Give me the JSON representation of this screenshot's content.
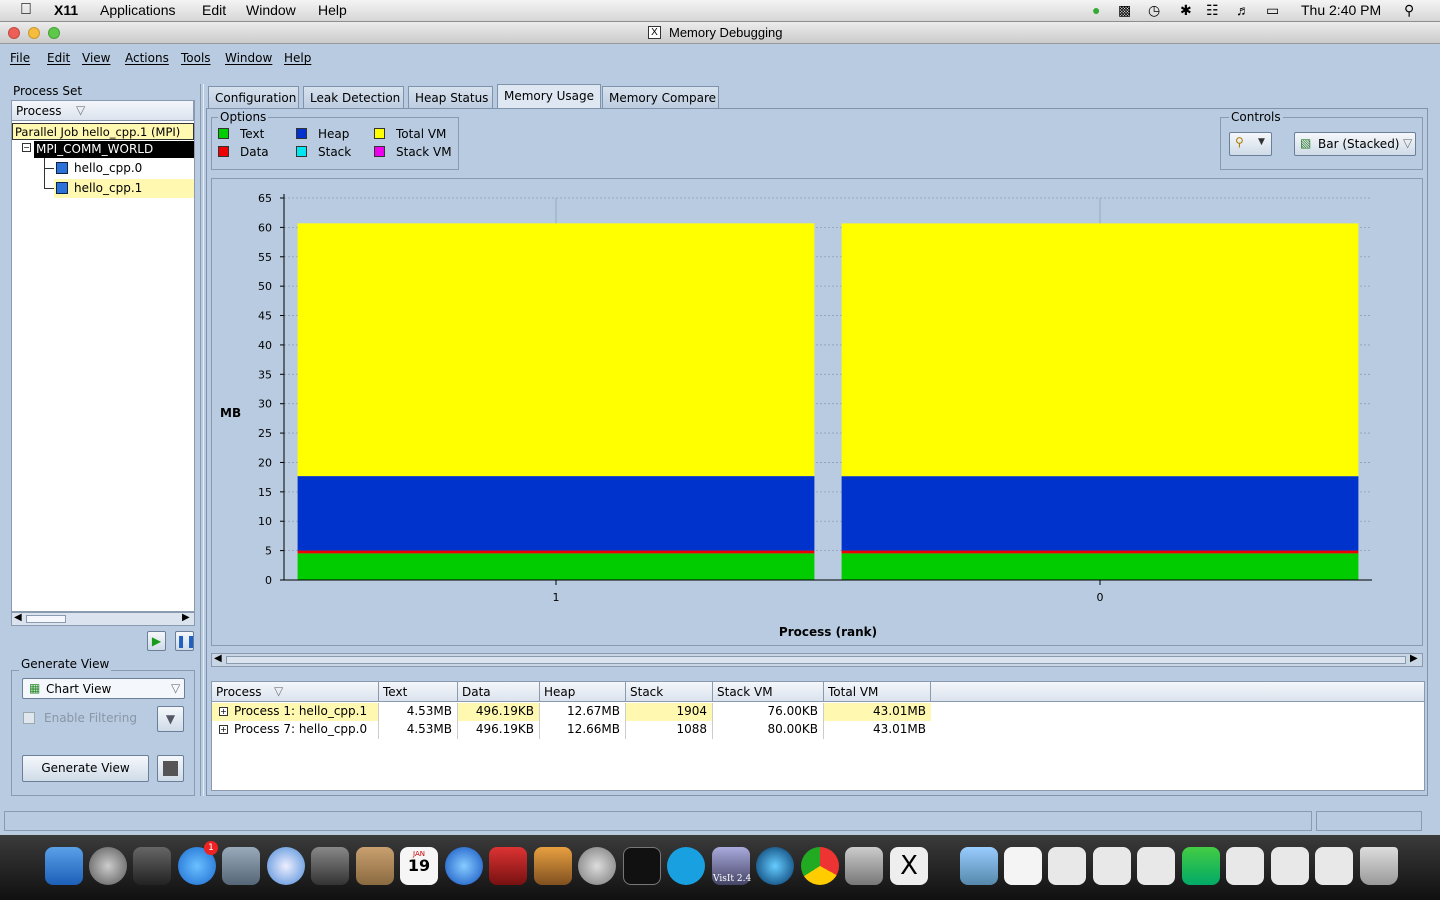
{
  "mac_menubar": {
    "app": "X11",
    "items": [
      "Applications",
      "Edit",
      "Window",
      "Help"
    ],
    "clock": "Thu 2:40 PM"
  },
  "window": {
    "title": "Memory Debugging"
  },
  "menubar": [
    "File",
    "Edit",
    "View",
    "Actions",
    "Tools",
    "Window",
    "Help"
  ],
  "process_set": {
    "title": "Process Set",
    "column_header": "Process",
    "tree": {
      "root": "Parallel Job hello_cpp.1 (MPI)",
      "group": "MPI_COMM_WORLD",
      "children": [
        "hello_cpp.0",
        "hello_cpp.1"
      ]
    }
  },
  "generate_view": {
    "title": "Generate View",
    "select_value": "Chart View",
    "filter_label": "Enable Filtering",
    "button_label": "Generate View"
  },
  "tabs": [
    "Configuration",
    "Leak Detection",
    "Heap Status",
    "Memory Usage",
    "Memory Compare"
  ],
  "active_tab": "Memory Usage",
  "options": {
    "title": "Options",
    "legend": [
      {
        "label": "Text",
        "color": "#00cc00"
      },
      {
        "label": "Data",
        "color": "#ee0000"
      },
      {
        "label": "Heap",
        "color": "#0033cc"
      },
      {
        "label": "Stack",
        "color": "#00e5ee"
      },
      {
        "label": "Total VM",
        "color": "#ffff00"
      },
      {
        "label": "Stack VM",
        "color": "#ee00ee"
      }
    ]
  },
  "controls": {
    "title": "Controls",
    "chart_type": "Bar (Stacked)"
  },
  "chart_data": {
    "type": "bar",
    "stacked": true,
    "categories": [
      "1",
      "0"
    ],
    "xlabel": "Process (rank)",
    "ylabel": "MB",
    "ylim": [
      0,
      65
    ],
    "yticks": [
      0,
      5,
      10,
      15,
      20,
      25,
      30,
      35,
      40,
      45,
      50,
      55,
      60,
      65
    ],
    "series": [
      {
        "name": "Text",
        "color": "#00cc00",
        "values": [
          4.53,
          4.53
        ]
      },
      {
        "name": "Data",
        "color": "#ee0000",
        "values": [
          0.48,
          0.48
        ]
      },
      {
        "name": "Heap",
        "color": "#0033cc",
        "values": [
          12.67,
          12.66
        ]
      },
      {
        "name": "Stack",
        "color": "#00e5ee",
        "values": [
          0.0,
          0.0
        ]
      },
      {
        "name": "Total VM",
        "color": "#ffff00",
        "values": [
          43.01,
          43.01
        ]
      }
    ]
  },
  "table": {
    "columns": [
      "Process",
      "Text",
      "Data",
      "Heap",
      "Stack",
      "Stack VM",
      "Total VM"
    ],
    "rows": [
      [
        "Process 1: hello_cpp.1",
        "4.53MB",
        "496.19KB",
        "12.67MB",
        "1904",
        "76.00KB",
        "43.01MB"
      ],
      [
        "Process 7: hello_cpp.0",
        "4.53MB",
        "496.19KB",
        "12.66MB",
        "1088",
        "80.00KB",
        "43.01MB"
      ]
    ]
  },
  "dock": {
    "visit_label": "VisIt 2.4",
    "calendar_month": "JAN",
    "calendar_day": "19",
    "badge": "1"
  }
}
